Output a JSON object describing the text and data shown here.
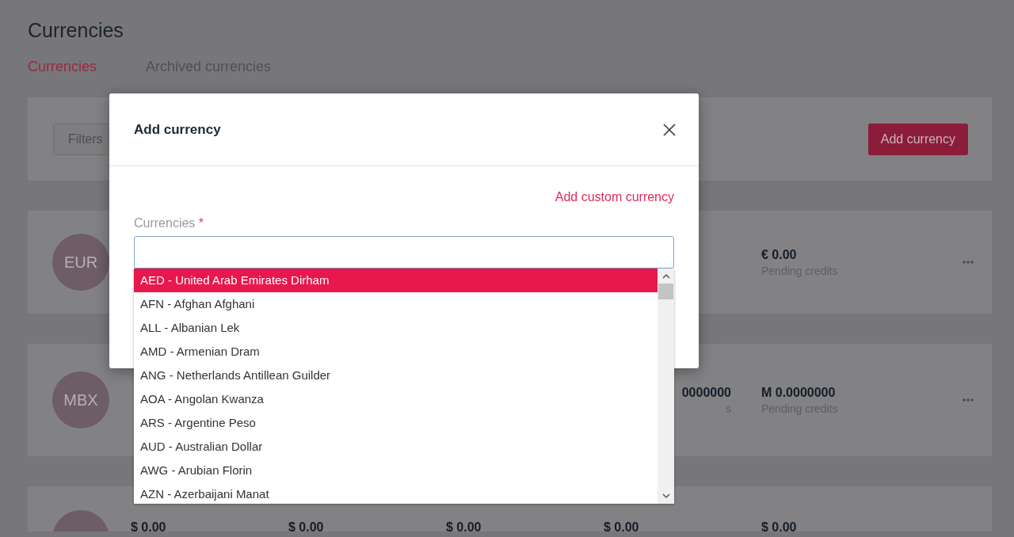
{
  "page": {
    "title": "Currencies"
  },
  "tabs": [
    {
      "label": "Currencies",
      "selected": true
    },
    {
      "label": "Archived currencies",
      "selected": false
    }
  ],
  "toolbar": {
    "filters_button": "Filters",
    "add_button": "Add currency"
  },
  "cards": [
    {
      "avatar": "EUR",
      "stats": [
        {
          "value": "€ 0.00",
          "label": "Pending credits"
        }
      ],
      "menu": true
    },
    {
      "avatar": "MBX",
      "stats": [
        {
          "value": "0000000",
          "label": "s",
          "clipped": true
        },
        {
          "value": "M 0.0000000",
          "label": "Pending credits"
        }
      ],
      "menu": true
    },
    {
      "stats": [
        {
          "value": "$ 0.00"
        },
        {
          "value": "$ 0.00"
        },
        {
          "value": "$ 0.00"
        },
        {
          "value": "$ 0.00"
        },
        {
          "value": "$ 0.00"
        }
      ],
      "menu": false
    }
  ],
  "dialog": {
    "title": "Add currency",
    "link": "Add custom currency",
    "field_label": "Currencies",
    "required_mark": "*",
    "options": [
      {
        "label": "AED - United Arab Emirates Dirham",
        "selected": true
      },
      {
        "label": "AFN - Afghan Afghani",
        "selected": false
      },
      {
        "label": "ALL - Albanian Lek",
        "selected": false
      },
      {
        "label": "AMD - Armenian Dram",
        "selected": false
      },
      {
        "label": "ANG - Netherlands Antillean Guilder",
        "selected": false
      },
      {
        "label": "AOA - Angolan Kwanza",
        "selected": false
      },
      {
        "label": "ARS - Argentine Peso",
        "selected": false
      },
      {
        "label": "AUD - Australian Dollar",
        "selected": false
      },
      {
        "label": "AWG - Arubian Florin",
        "selected": false
      },
      {
        "label": "AZN - Azerbaijani Manat",
        "selected": false
      }
    ]
  }
}
